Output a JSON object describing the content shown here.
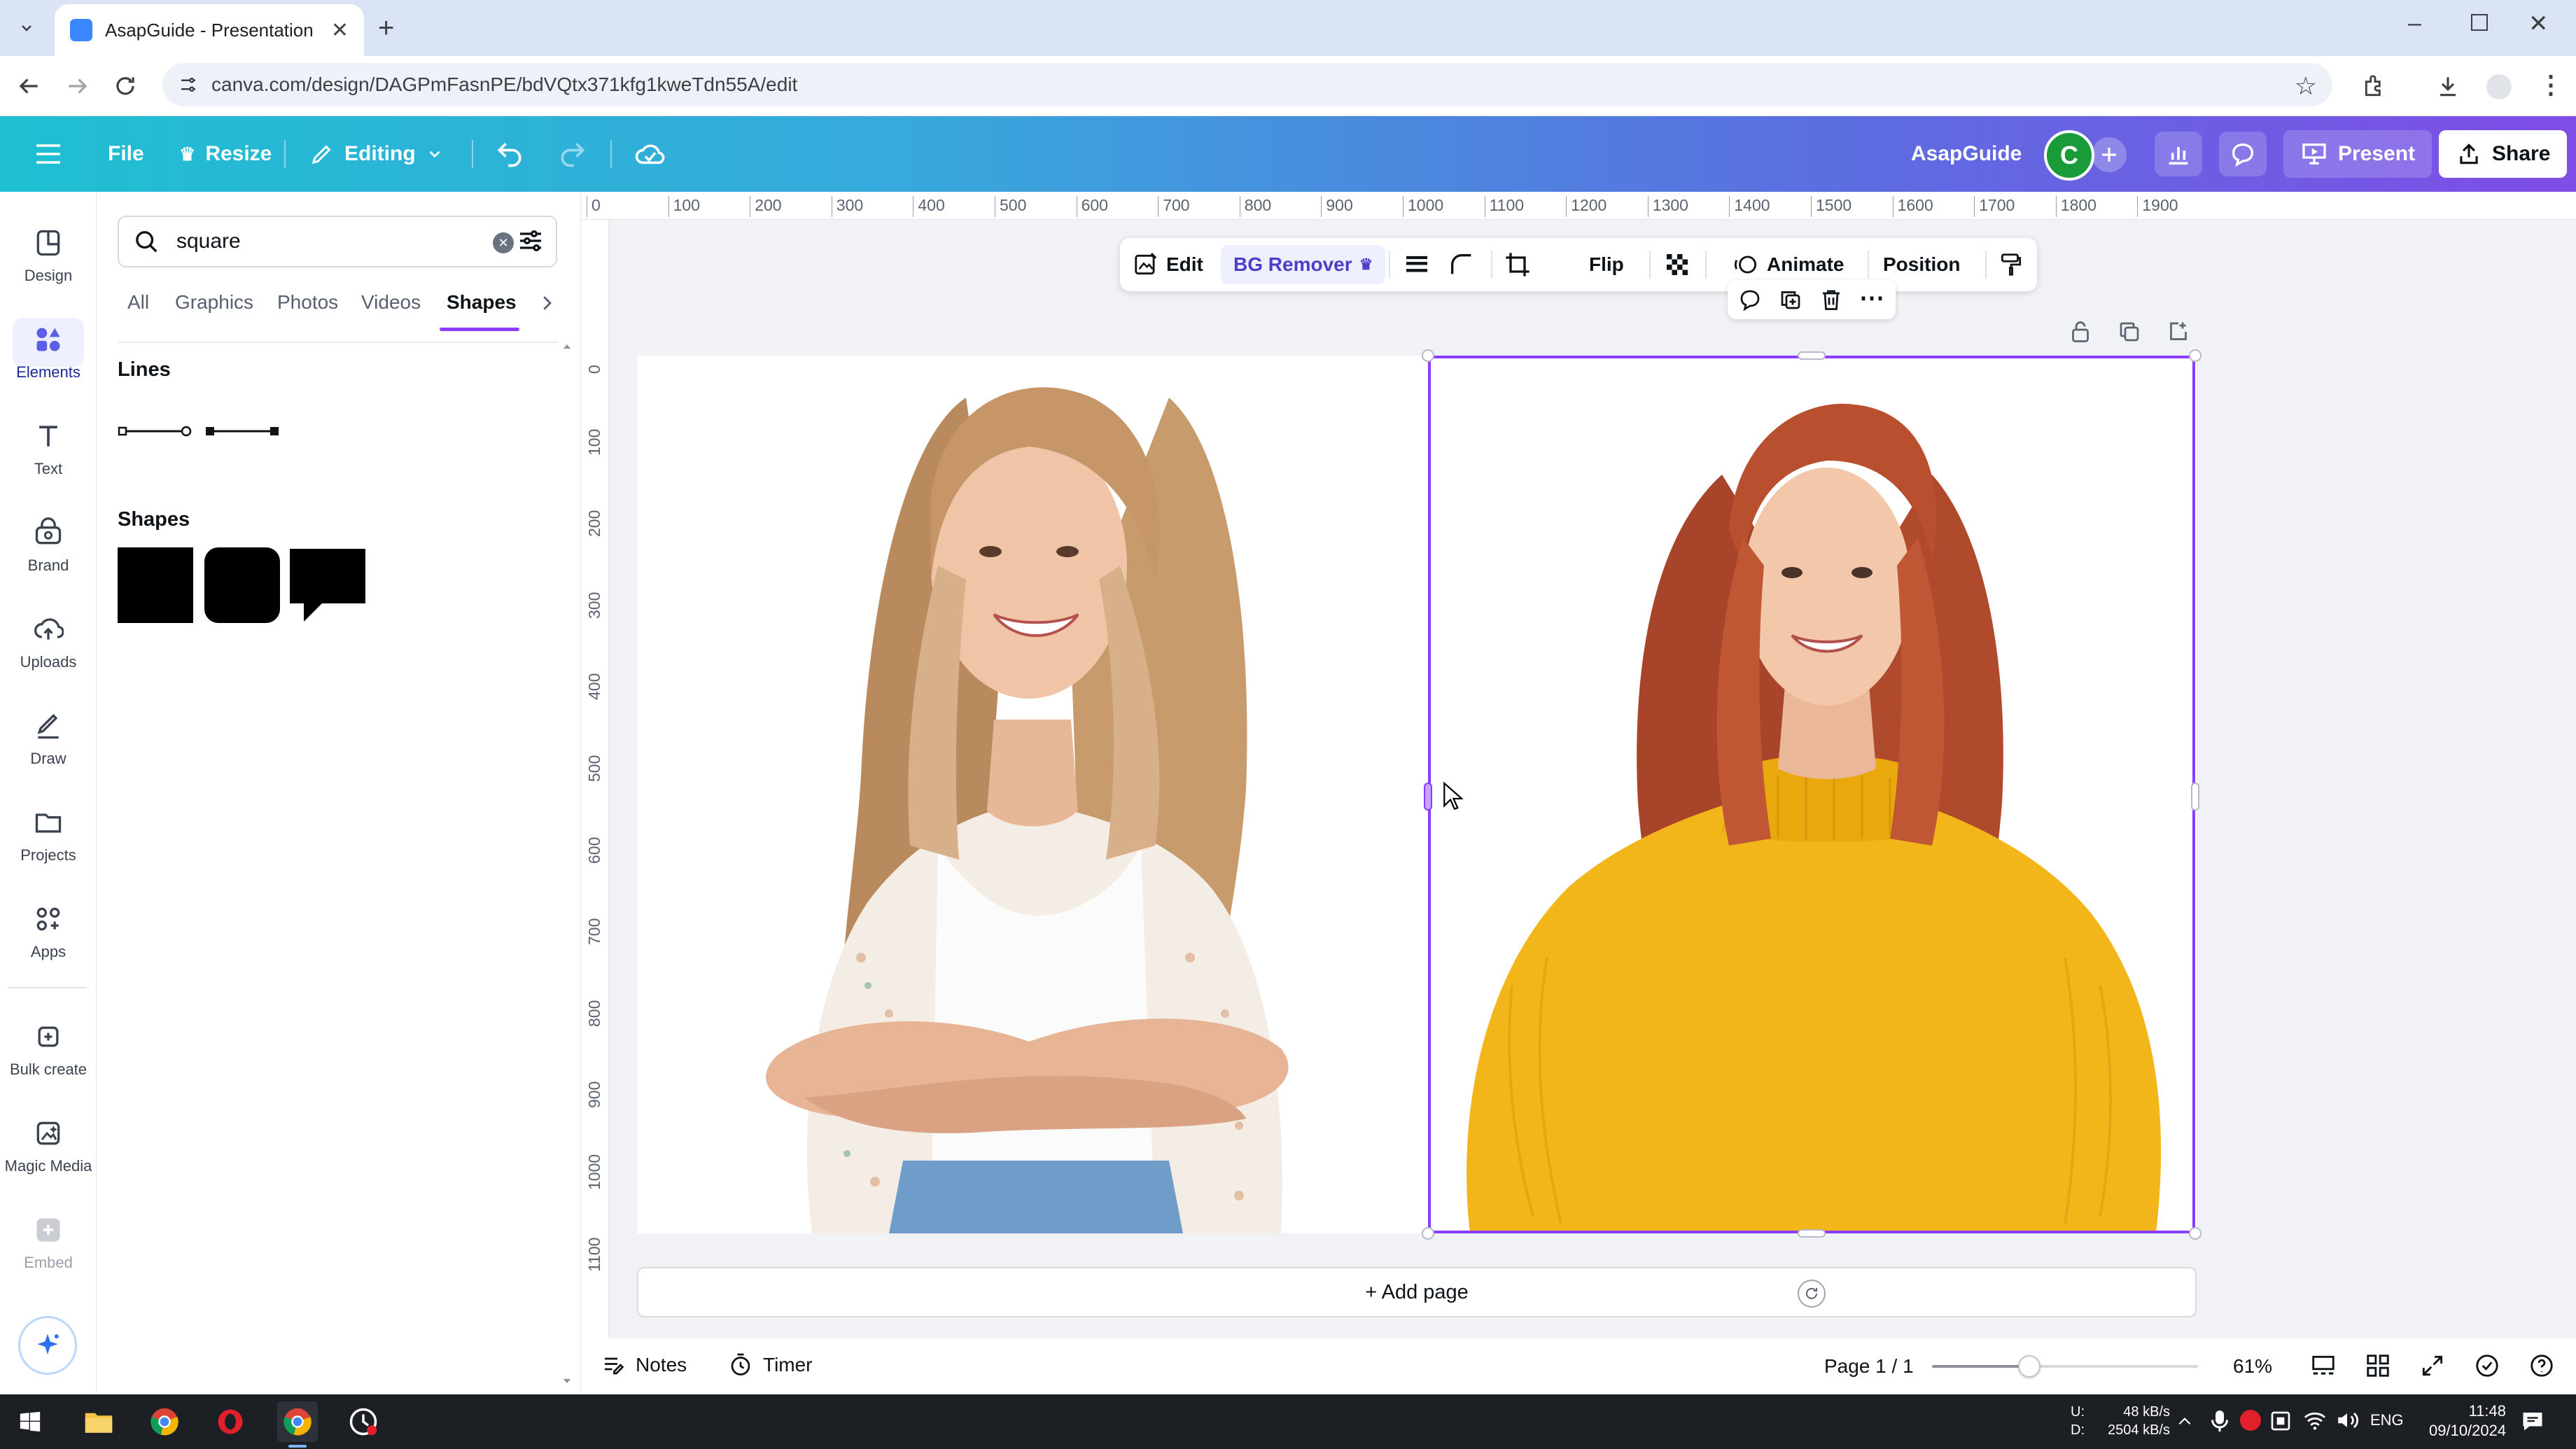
{
  "browser": {
    "tab_title": "AsapGuide - Presentation",
    "url": "canva.com/design/DAGPmFasnPE/bdVQtx371kfg1kweTdn55A/edit"
  },
  "header": {
    "file_label": "File",
    "resize_label": "Resize",
    "editing_label": "Editing",
    "team_name": "AsapGuide",
    "avatar_letter": "C",
    "present_label": "Present",
    "share_label": "Share"
  },
  "rail": {
    "items": [
      {
        "label": "Design",
        "icon": "design-icon"
      },
      {
        "label": "Elements",
        "icon": "elements-icon"
      },
      {
        "label": "Text",
        "icon": "text-icon"
      },
      {
        "label": "Brand",
        "icon": "brand-icon"
      },
      {
        "label": "Uploads",
        "icon": "uploads-icon"
      },
      {
        "label": "Draw",
        "icon": "draw-icon"
      },
      {
        "label": "Projects",
        "icon": "projects-icon"
      },
      {
        "label": "Apps",
        "icon": "apps-icon"
      },
      {
        "label": "Bulk create",
        "icon": "bulk-create-icon"
      },
      {
        "label": "Magic Media",
        "icon": "magic-media-icon"
      },
      {
        "label": "Embed",
        "icon": "embed-icon"
      }
    ]
  },
  "panel": {
    "search_value": "square",
    "tabs": [
      "All",
      "Graphics",
      "Photos",
      "Videos",
      "Shapes"
    ],
    "active_tab": "Shapes",
    "lines_heading": "Lines",
    "shapes_heading": "Shapes"
  },
  "ruler": {
    "top_ticks": [
      "0",
      "100",
      "200",
      "300",
      "400",
      "500",
      "600",
      "700",
      "800",
      "900",
      "1000",
      "1100",
      "1200",
      "1300",
      "1400",
      "1500",
      "1600",
      "1700",
      "1800",
      "1900"
    ],
    "left_ticks": [
      "0",
      "100",
      "200",
      "300",
      "400",
      "500",
      "600",
      "700",
      "800",
      "900",
      "1000",
      "1100"
    ]
  },
  "context_toolbar": {
    "edit_label": "Edit",
    "bg_remover_label": "BG Remover",
    "flip_label": "Flip",
    "animate_label": "Animate",
    "position_label": "Position"
  },
  "canvas": {
    "add_page_label": "+ Add page"
  },
  "bottom": {
    "notes_label": "Notes",
    "timer_label": "Timer",
    "page_indicator": "Page 1 / 1",
    "zoom_label": "61%",
    "zoom_level": 0.61
  },
  "taskbar": {
    "net_up": "48 kB/s",
    "net_down": "2504 kB/s",
    "net_up_prefix": "U:",
    "net_down_prefix": "D:",
    "lang": "ENG",
    "time": "11:48",
    "date": "09/10/2024"
  },
  "colors": {
    "selection": "#8b3dff",
    "header_start": "#1fbfd1",
    "header_end": "#7f4de6",
    "avatar_bg": "#1a9b3a",
    "sweater": "#f2b51a"
  }
}
